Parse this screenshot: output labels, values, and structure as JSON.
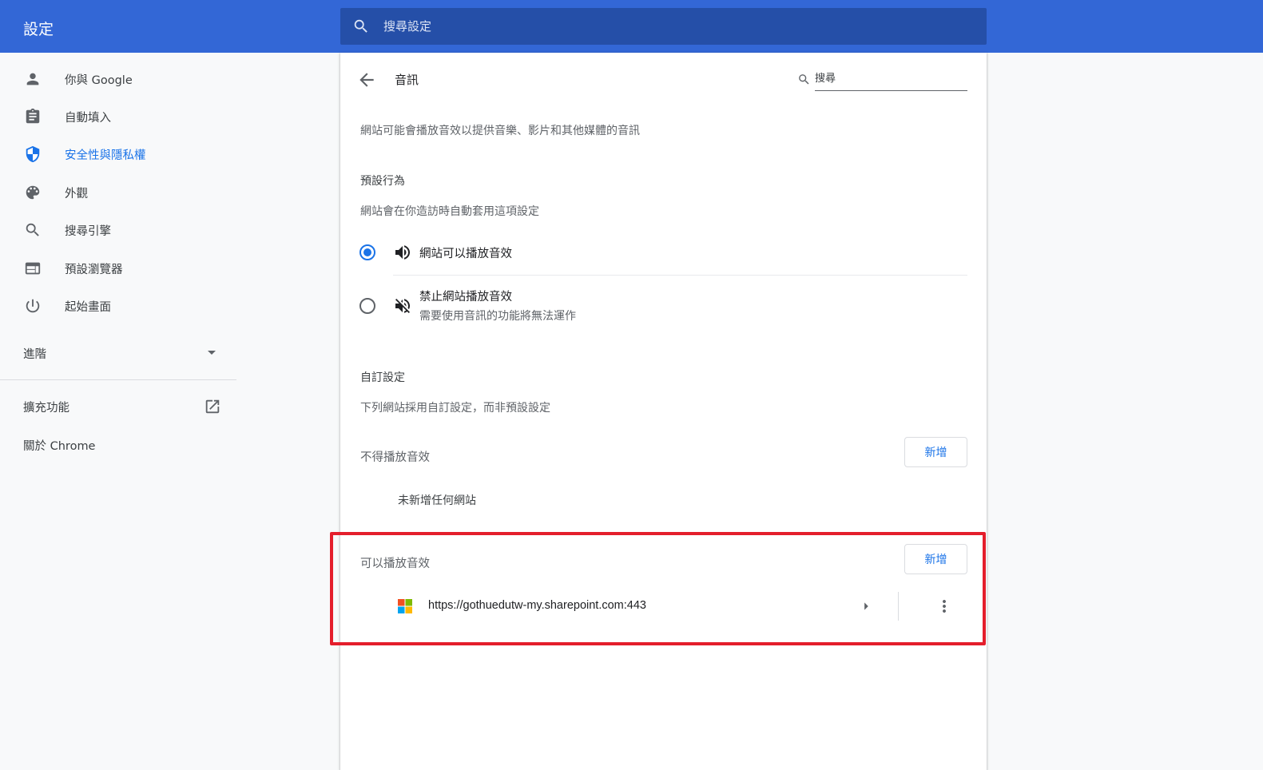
{
  "app": {
    "title": "設定"
  },
  "top_search": {
    "placeholder": "搜尋設定",
    "icon": "search-icon"
  },
  "sidebar": {
    "items": [
      {
        "label": "你與 Google",
        "icon": "person-icon",
        "active": false
      },
      {
        "label": "自動填入",
        "icon": "clipboard-icon",
        "active": false
      },
      {
        "label": "安全性與隱私權",
        "icon": "shield-icon",
        "active": true
      },
      {
        "label": "外觀",
        "icon": "palette-icon",
        "active": false
      },
      {
        "label": "搜尋引擎",
        "icon": "search-icon",
        "active": false
      },
      {
        "label": "預設瀏覽器",
        "icon": "browser-window-icon",
        "active": false
      },
      {
        "label": "起始畫面",
        "icon": "power-icon",
        "active": false
      }
    ],
    "advanced_label": "進階",
    "extensions_label": "擴充功能",
    "about_label": "關於 Chrome"
  },
  "content": {
    "title": "音訊",
    "search_placeholder": "搜尋",
    "description": "網站可能會播放音效以提供音樂、影片和其他媒體的音訊",
    "default_behavior": {
      "heading": "預設行為",
      "subtext": "網站會在你造訪時自動套用這項設定",
      "options": [
        {
          "label": "網站可以播放音效",
          "sub": "",
          "checked": true,
          "icon": "volume-up-icon"
        },
        {
          "label": "禁止網站播放音效",
          "sub": "需要使用音訊的功能將無法運作",
          "checked": false,
          "icon": "volume-off-icon"
        }
      ]
    },
    "custom": {
      "heading": "自訂設定",
      "subtext": "下列網站採用自訂設定，而非預設設定",
      "blocked": {
        "label": "不得播放音效",
        "add_label": "新增",
        "empty_text": "未新增任何網站"
      },
      "allowed": {
        "label": "可以播放音效",
        "add_label": "新增",
        "sites": [
          {
            "url": "https://gothuedutw-my.sharepoint.com:443",
            "icon": "microsoft-logo-icon"
          }
        ]
      }
    }
  },
  "colors": {
    "topbar": "#3367d6",
    "top_search": "#254fa8",
    "accent": "#1a73e8",
    "highlight": "#e41e2b"
  }
}
